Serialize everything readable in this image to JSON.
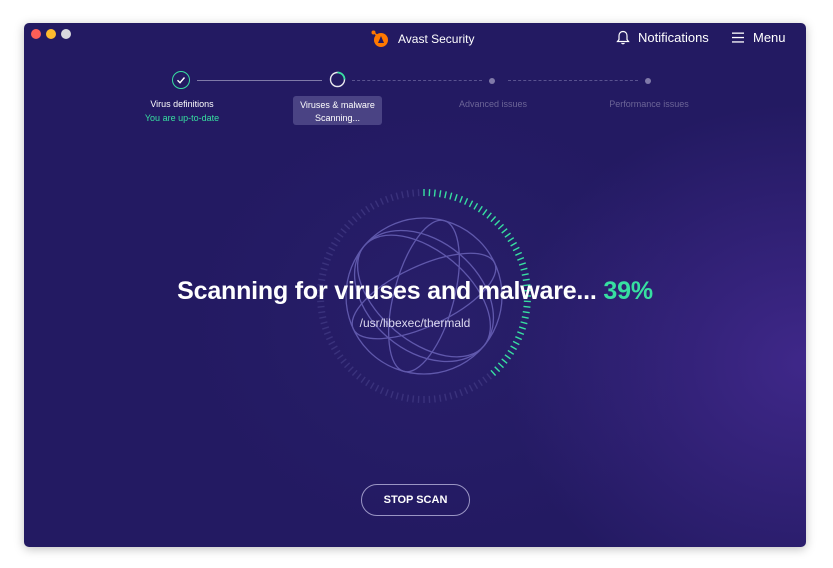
{
  "app": {
    "title": "Avast Security"
  },
  "header": {
    "notifications_label": "Notifications",
    "menu_label": "Menu"
  },
  "steps": [
    {
      "label": "Virus definitions",
      "status": "You are up-to-date",
      "state": "done"
    },
    {
      "label": "Viruses & malware",
      "status": "Scanning...",
      "state": "active"
    },
    {
      "label": "Advanced issues",
      "state": "pending"
    },
    {
      "label": "Performance issues",
      "state": "pending"
    }
  ],
  "scan": {
    "headline": "Scanning for viruses and malware...",
    "percent": "39%",
    "progress": 0.39,
    "current_file": "/usr/libexec/thermald",
    "stop_label": "STOP SCAN"
  },
  "colors": {
    "accent": "#37dfa1",
    "background": "#231a62",
    "brand_orange": "#ff7800"
  },
  "icons": {
    "notifications": "bell-icon",
    "menu": "hamburger-icon",
    "step_done": "checkmark-icon"
  }
}
